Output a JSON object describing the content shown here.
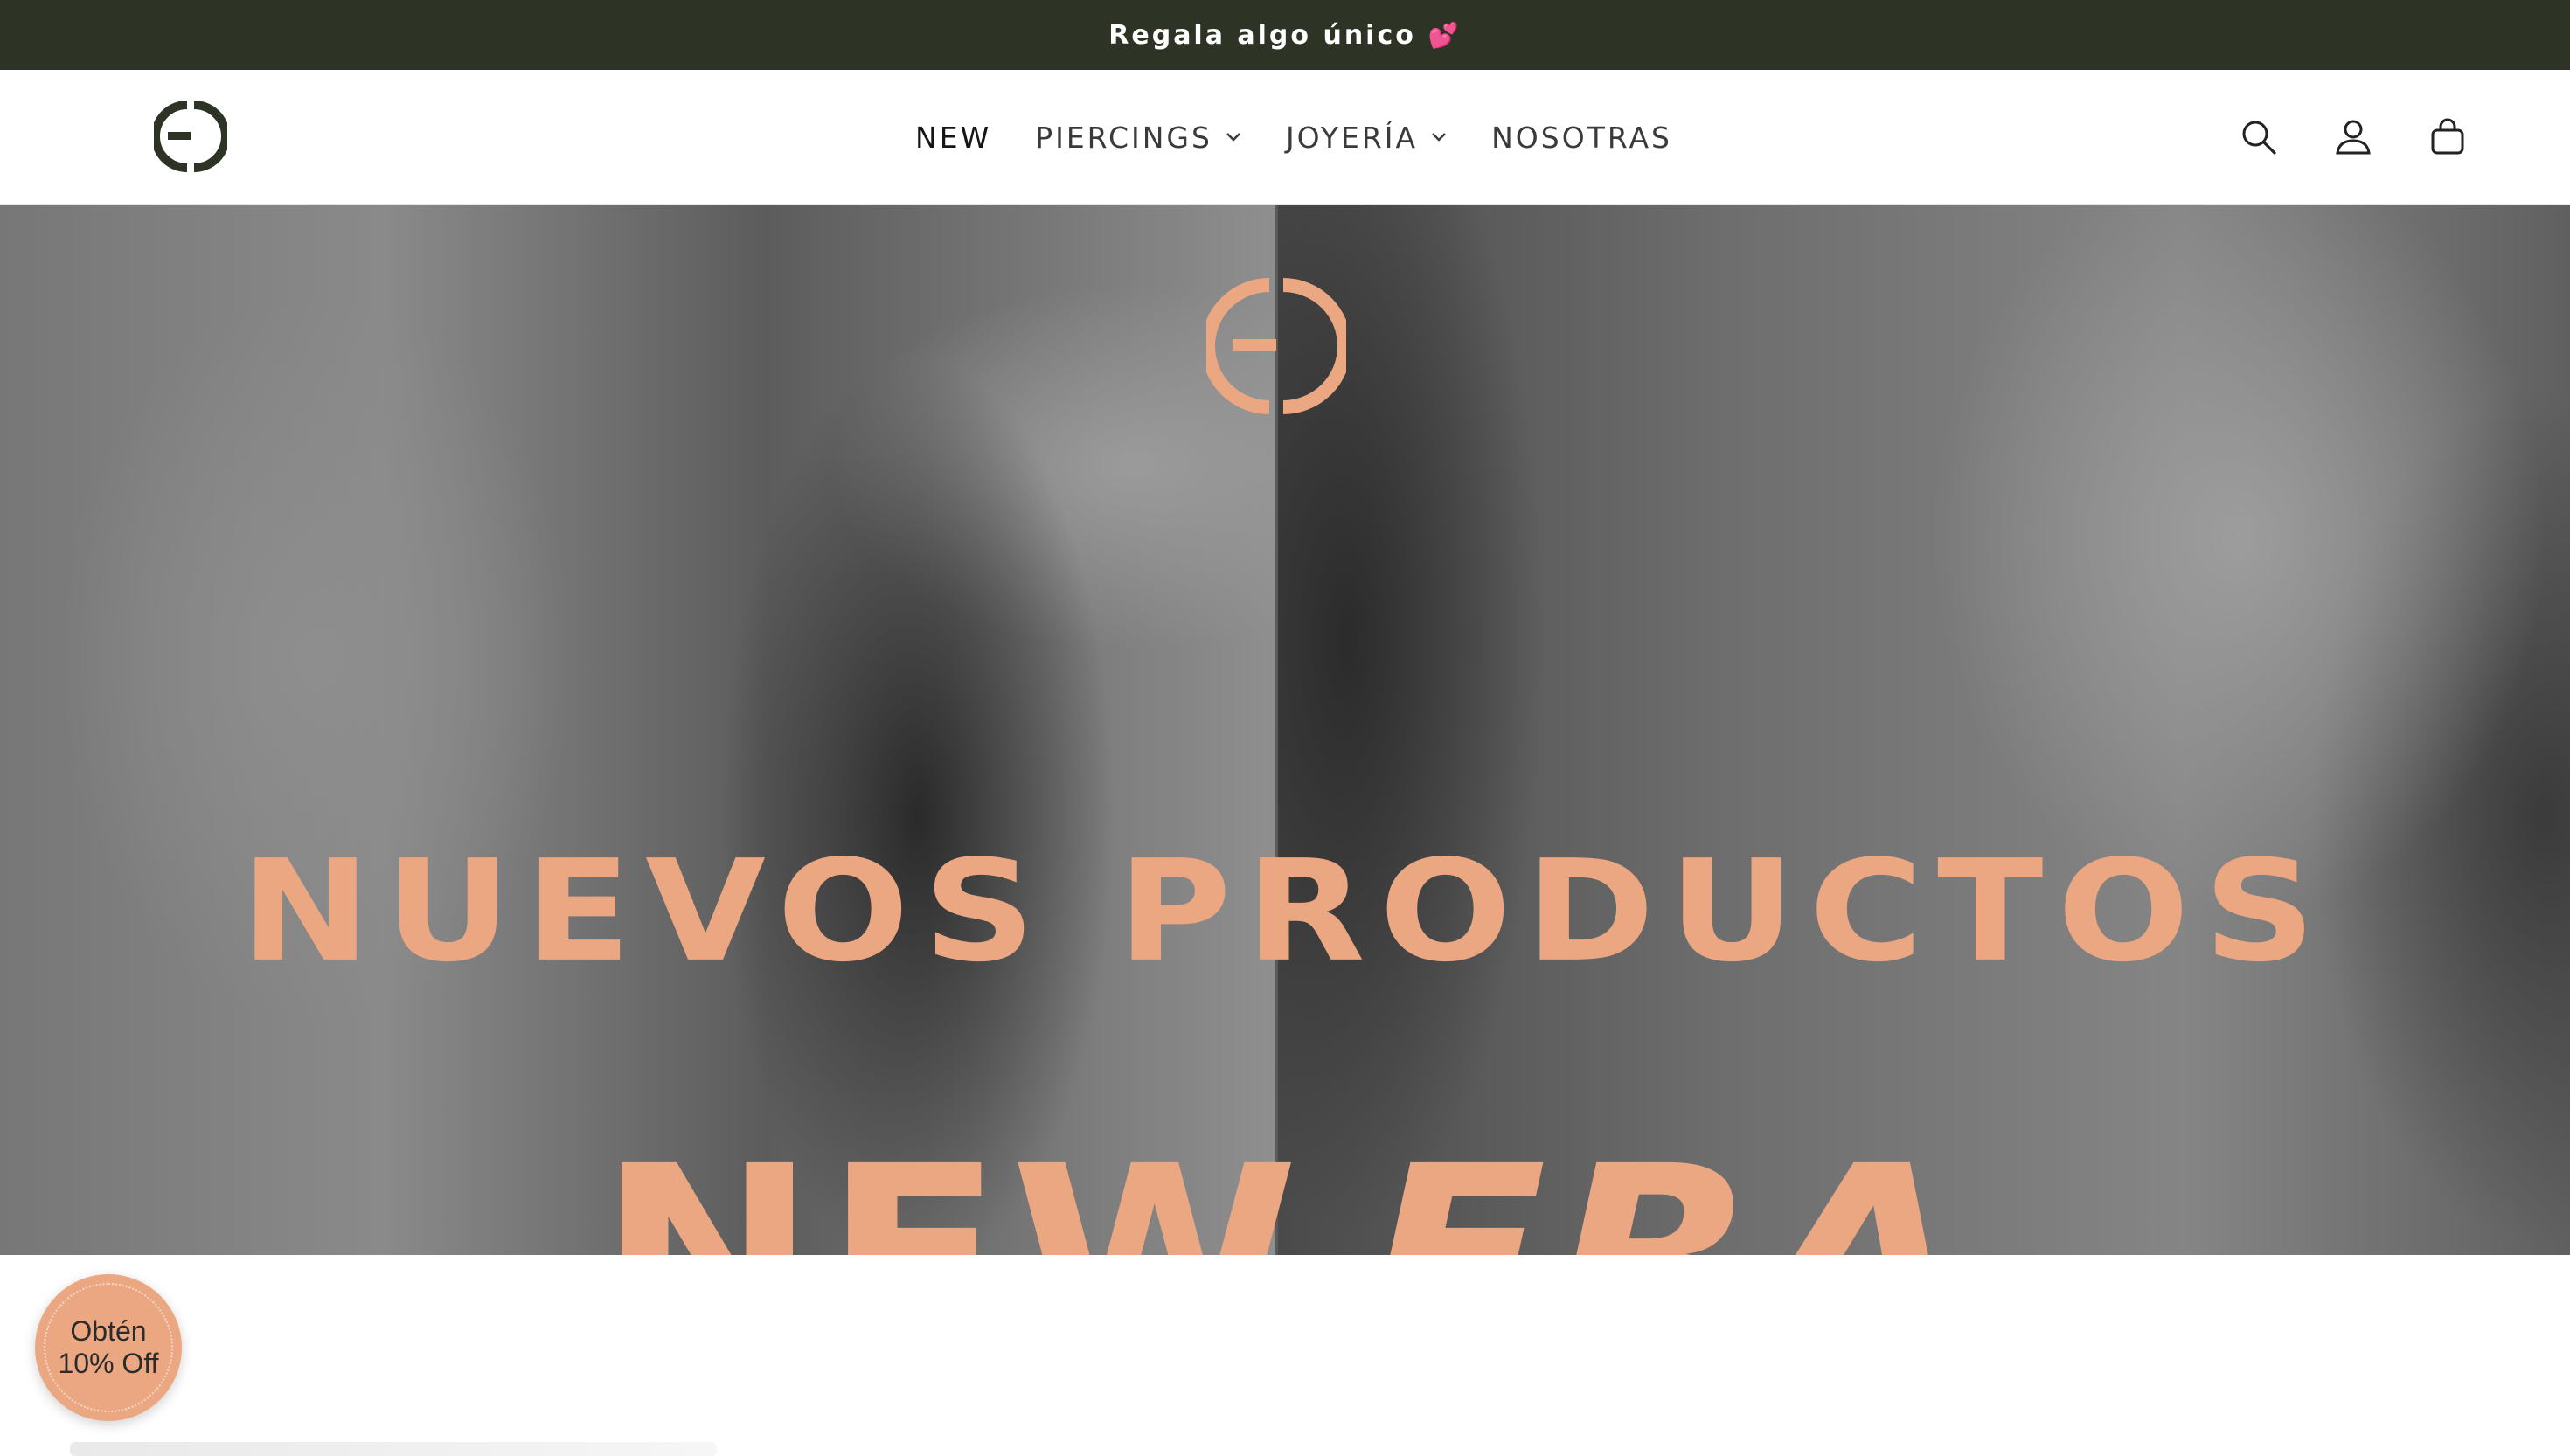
{
  "announcement": {
    "text": "Regala algo único",
    "emoji": "💕"
  },
  "brand": {
    "logo_icon": "brand-logo-icon",
    "color": "#2d3325",
    "accent": "#eba782"
  },
  "nav": {
    "items": [
      {
        "label": "NEW",
        "has_dropdown": false
      },
      {
        "label": "PIERCINGS",
        "has_dropdown": true
      },
      {
        "label": "JOYERÍA",
        "has_dropdown": true
      },
      {
        "label": "NOSOTRAS",
        "has_dropdown": false
      }
    ]
  },
  "header_icons": [
    "search-icon",
    "account-icon",
    "cart-icon"
  ],
  "hero": {
    "title": "NUEVOS PRODUCTOS",
    "subtitle_regular": "NEW",
    "subtitle_italic": "ERA"
  },
  "promo": {
    "line1": "Obtén",
    "line2": "10% Off"
  }
}
